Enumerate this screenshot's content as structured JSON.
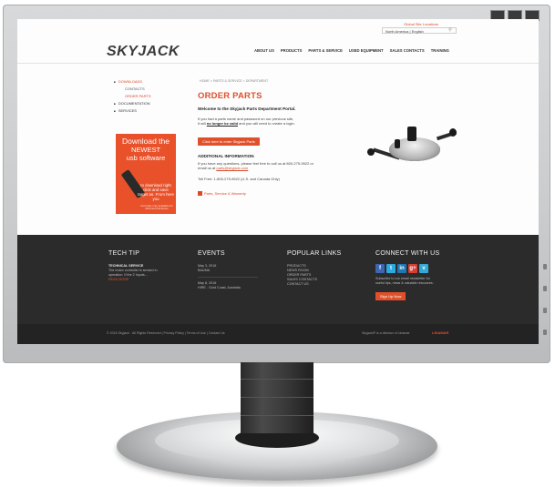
{
  "colors": {
    "accent": "#e0502a",
    "footer_bg": "#2b2b2b",
    "bezel": "#cbcdcf"
  },
  "header": {
    "top_link": "Global Site Locations",
    "language": "North America | English",
    "logo_main": "SKYJACK",
    "logo_accent": "J",
    "nav": [
      "ABOUT US",
      "PRODUCTS",
      "PARTS & SERVICE",
      "USED EQUIPMENT",
      "SALES CONTACTS",
      "TRAINING"
    ]
  },
  "sidebar": {
    "items": [
      {
        "label": "DOWNLOADS",
        "kind": "bullet-active"
      },
      {
        "label": "CONTACTS",
        "kind": "sub"
      },
      {
        "label": "ORDER PARTS",
        "kind": "sub-active"
      },
      {
        "label": "DOCUMENTATION",
        "kind": "bullet"
      },
      {
        "label": "SERVICES",
        "kind": "bullet"
      }
    ],
    "promo": {
      "line1": "Download the",
      "line2": "NEWEST",
      "line3": "usb software",
      "small": "to download right click and save target as. From here you",
      "tiny": "Currently only available for Microsoft Windows"
    }
  },
  "main": {
    "breadcrumb": "HOME > PARTS & SERVICE > DEPARTMENT",
    "title": "ORDER PARTS",
    "welcome": "Welcome to the Skyjack Parts Department Portal.",
    "p1_a": "If you had a parts name and password on our previous site,",
    "p1_b": "it will",
    "p1_link": "no longer be valid",
    "p1_c": "and you will need to create a login.",
    "portal_button": "Click here to enter Skyjack Parts",
    "addl_title": "ADDITIONAL INFORMATION",
    "p2_a": "If you have any questions, please feel free to call us at 800-275-9522 or",
    "p2_b": "email us at",
    "p2_link": "parts@skyjack.com",
    "p3": "Toll Free: 1-800-275-9522 (U.S. and Canada Only)",
    "pdf_link": "Parts, Service & Warranty"
  },
  "footer": {
    "tech_tip": {
      "title": "TECH TIP",
      "heading": "TECHNICAL SERVICE",
      "text_a": "The motor controller is sensed in",
      "text_b": "operation. If the 2 Inputs...",
      "read_more": "READ MORE"
    },
    "events": {
      "title": "EVENTS",
      "e1_date": "May 3, 2016",
      "e1_name": "BAUMA",
      "e2_date": "May 8, 2016",
      "e2_name": "HIRE - Gold Coast, Australia"
    },
    "popular": {
      "title": "POPULAR LINKS",
      "links": [
        "PRODUCTS",
        "NEWS ROOM",
        "ORDER PARTS",
        "SALES CONTACTS",
        "CONTACT US"
      ]
    },
    "connect": {
      "title": "CONNECT WITH US",
      "social": [
        {
          "name": "facebook-icon",
          "glyph": "f",
          "color": "#3b66b0"
        },
        {
          "name": "twitter-icon",
          "glyph": "t",
          "color": "#2ba9e1"
        },
        {
          "name": "linkedin-icon",
          "glyph": "in",
          "color": "#1d78b4"
        },
        {
          "name": "googleplus-icon",
          "glyph": "g+",
          "color": "#d73d32"
        },
        {
          "name": "vimeo-icon",
          "glyph": "v",
          "color": "#35a8d6"
        }
      ],
      "text_a": "Subscribe to our email newsletter for",
      "text_b": "useful tips, news & valuable resources.",
      "signup": "Sign Up Now"
    },
    "copyright": "© 2016 Skyjack · All Rights Reserved | Privacy Policy | Terms of Use | Contact Us",
    "bottom_right": "Skyjack® is a division of Linamar",
    "bottom_logo": "LINAMAR"
  }
}
